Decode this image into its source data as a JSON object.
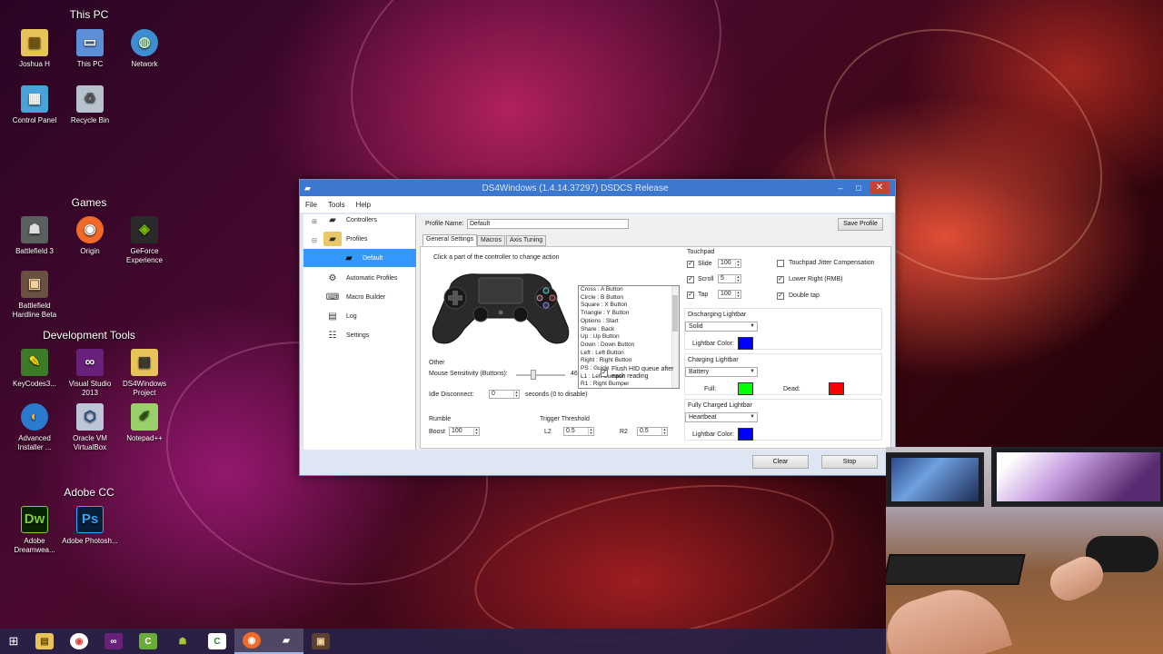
{
  "desktop": {
    "group_this_pc": "This PC",
    "group_games": "Games",
    "group_dev": "Development Tools",
    "group_adobe": "Adobe CC",
    "icons": {
      "joshua": "Joshua H",
      "thispc": "This PC",
      "network": "Network",
      "control_panel": "Control Panel",
      "recycle_bin": "Recycle Bin",
      "bf3": "Battlefield 3",
      "origin": "Origin",
      "geforce": "GeForce Experience",
      "bf_hardline": "Battlefield Hardline Beta",
      "keycodes": "KeyCodes3...",
      "vs2013": "Visual Studio 2013",
      "ds4project": "DS4Windows Project",
      "advanced_installer": "Advanced Installer ...",
      "virtualbox": "Oracle VM VirtualBox",
      "notepadpp": "Notepad++",
      "dreamweaver": "Adobe Dreamwea...",
      "photoshop": "Adobe Photosh..."
    }
  },
  "window": {
    "title": "DS4Windows (1.4.14.37297) DSDCS Release",
    "minimize": "‒",
    "maximize": "□",
    "close": "✕",
    "menu": [
      "File",
      "Tools",
      "Help"
    ],
    "nav": {
      "controllers": "Controllers",
      "profiles": "Profiles",
      "default": "Default",
      "auto_profiles": "Automatic Profiles",
      "macro_builder": "Macro Builder",
      "log": "Log",
      "settings": "Settings"
    },
    "profile_name_label": "Profile Name:",
    "profile_name_value": "Default",
    "save_profile": "Save Profile",
    "tabs": [
      "General Settings",
      "Macros",
      "Axis Tuning"
    ],
    "controller_hint": "Click a part of the controller to change action",
    "action_list": [
      "Cross : A Button",
      "Circle : B Button",
      "Square : X Button",
      "Triangle : Y Button",
      "Options : Start",
      "Share : Back",
      "Up : Up Button",
      "Down : Down Button",
      "Left : Left Button",
      "Right : Right Button",
      "PS : Guide",
      "L1 : Left Bumper",
      "R1 : Right Bumper"
    ],
    "other": {
      "title": "Other",
      "mouse_sens_label": "Mouse Sensitivity (Buttons):",
      "mouse_sens_value": "46",
      "mouse_sens_fraction": 0.35,
      "flush_hid": "Flush HID queue after each reading",
      "idle_label": "Idle Disconnect:",
      "idle_value": "0",
      "idle_suffix": "seconds (0 to disable)"
    },
    "rumble": {
      "title": "Rumble",
      "boost_label": "Boost",
      "boost_value": "100"
    },
    "trigger": {
      "title": "Trigger Threshold",
      "l2_label": "L2",
      "l2_value": "0.5",
      "r2_label": "R2",
      "r2_value": "0.5"
    },
    "touchpad": {
      "title": "Touchpad",
      "slide_label": "Slide",
      "slide_value": "100",
      "scroll_label": "Scroll",
      "scroll_value": "5",
      "tap_label": "Tap",
      "tap_value": "100",
      "jitter": "Touchpad Jitter Compensation",
      "lower_right": "Lower Right (RMB)",
      "double_tap": "Double tap"
    },
    "lightbar": {
      "discharging_title": "Discharging Lightbar",
      "discharging_mode": "Solid",
      "discharging_color_label": "Lightbar Color:",
      "charging_title": "Charging Lightbar",
      "charging_mode": "Battery",
      "full_label": "Full:",
      "dead_label": "Dead:",
      "fully_charged_title": "Fully Charged Lightbar",
      "fully_charged_mode": "Heartbeat",
      "fully_color_label": "Lightbar Color:"
    },
    "colors": {
      "discharging": "#0000ff",
      "full": "#00ff00",
      "dead": "#ff0000",
      "fully_charged": "#0000ff"
    },
    "clear": "Clear",
    "stop": "Stop"
  },
  "taskbar": {
    "items": [
      "start-icon",
      "file-explorer-icon",
      "chrome-icon",
      "visual-studio-icon",
      "camtasia-icon",
      "android-icon",
      "camtasia-recorder-icon",
      "origin-icon",
      "ds4windows-icon",
      "battlefield-icon"
    ]
  }
}
